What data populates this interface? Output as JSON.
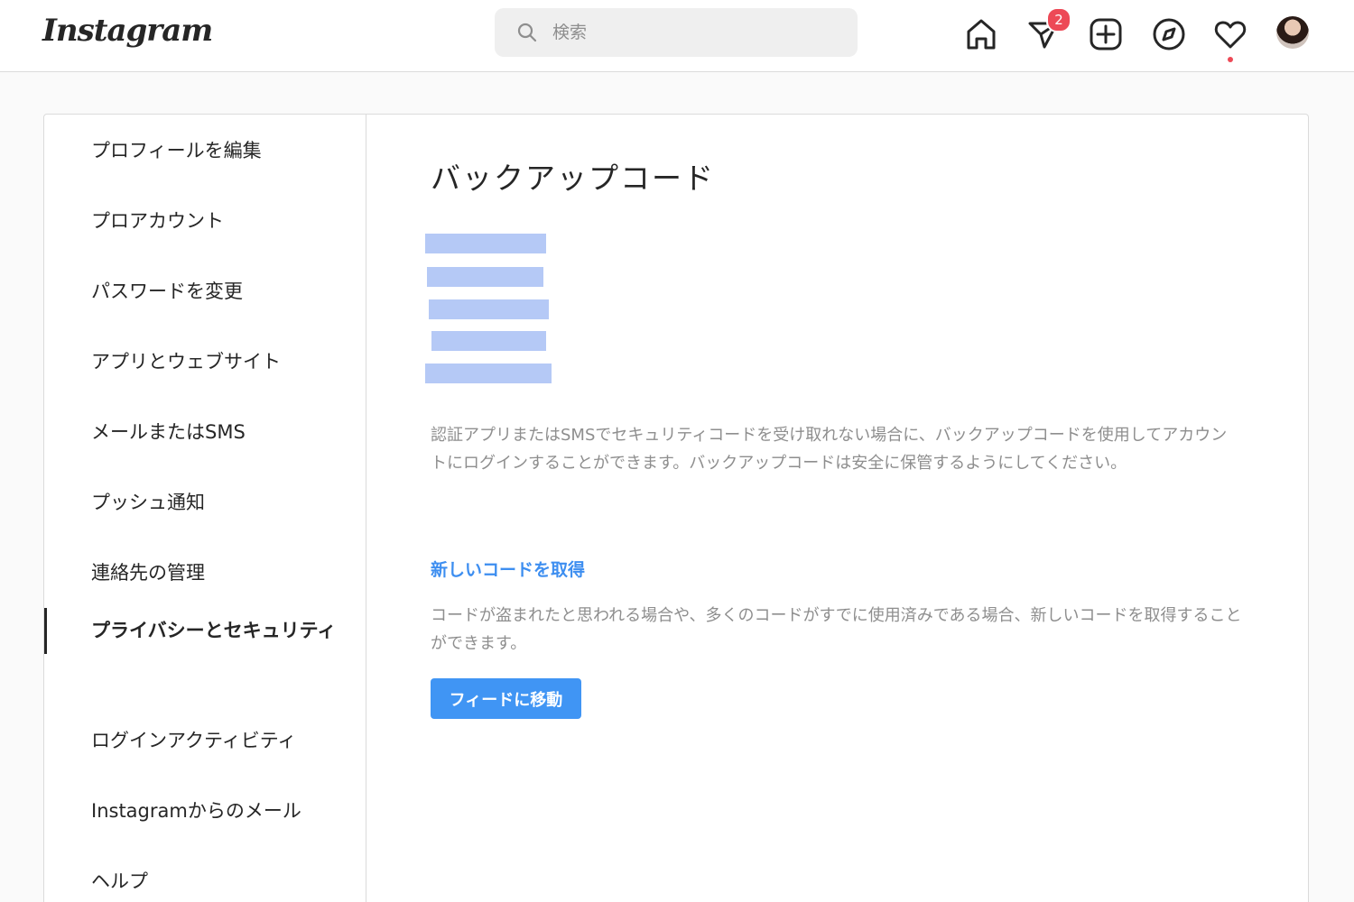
{
  "header": {
    "logo_text": "Instagram",
    "search_placeholder": "検索",
    "direct_badge_count": "2",
    "icons": [
      "home-icon",
      "direct-icon",
      "new-post-icon",
      "explore-icon",
      "activity-icon",
      "avatar"
    ]
  },
  "sidebar": {
    "items": [
      {
        "label": "プロフィールを編集"
      },
      {
        "label": "プロアカウント"
      },
      {
        "label": "パスワードを変更"
      },
      {
        "label": "アプリとウェブサイト"
      },
      {
        "label": "メールまたはSMS"
      },
      {
        "label": "プッシュ通知"
      },
      {
        "label": "連絡先の管理"
      },
      {
        "label": "プライバシーとセキュリティ",
        "active": true
      },
      {
        "label": "ログインアクティビティ"
      },
      {
        "label": "Instagramからのメール"
      },
      {
        "label": "ヘルプ"
      }
    ]
  },
  "main": {
    "title": "バックアップコード",
    "codes_redacted": 5,
    "description": "認証アプリまたはSMSでセキュリティコードを受け取れない場合に、バックアップコードを使用してアカウントにログインすることができます。バックアップコードは安全に保管するようにしてください。",
    "new_code_link": "新しいコードを取得",
    "new_code_description": "コードが盗まれたと思われる場合や、多くのコードがすでに使用済みである場合、新しいコードを取得することができます。",
    "feed_button_label": "フィードに移動"
  },
  "colors": {
    "accent": "#4095f4",
    "link": "#3d8ef0",
    "badge": "#ed4956",
    "redaction": "#b5c9f6"
  }
}
